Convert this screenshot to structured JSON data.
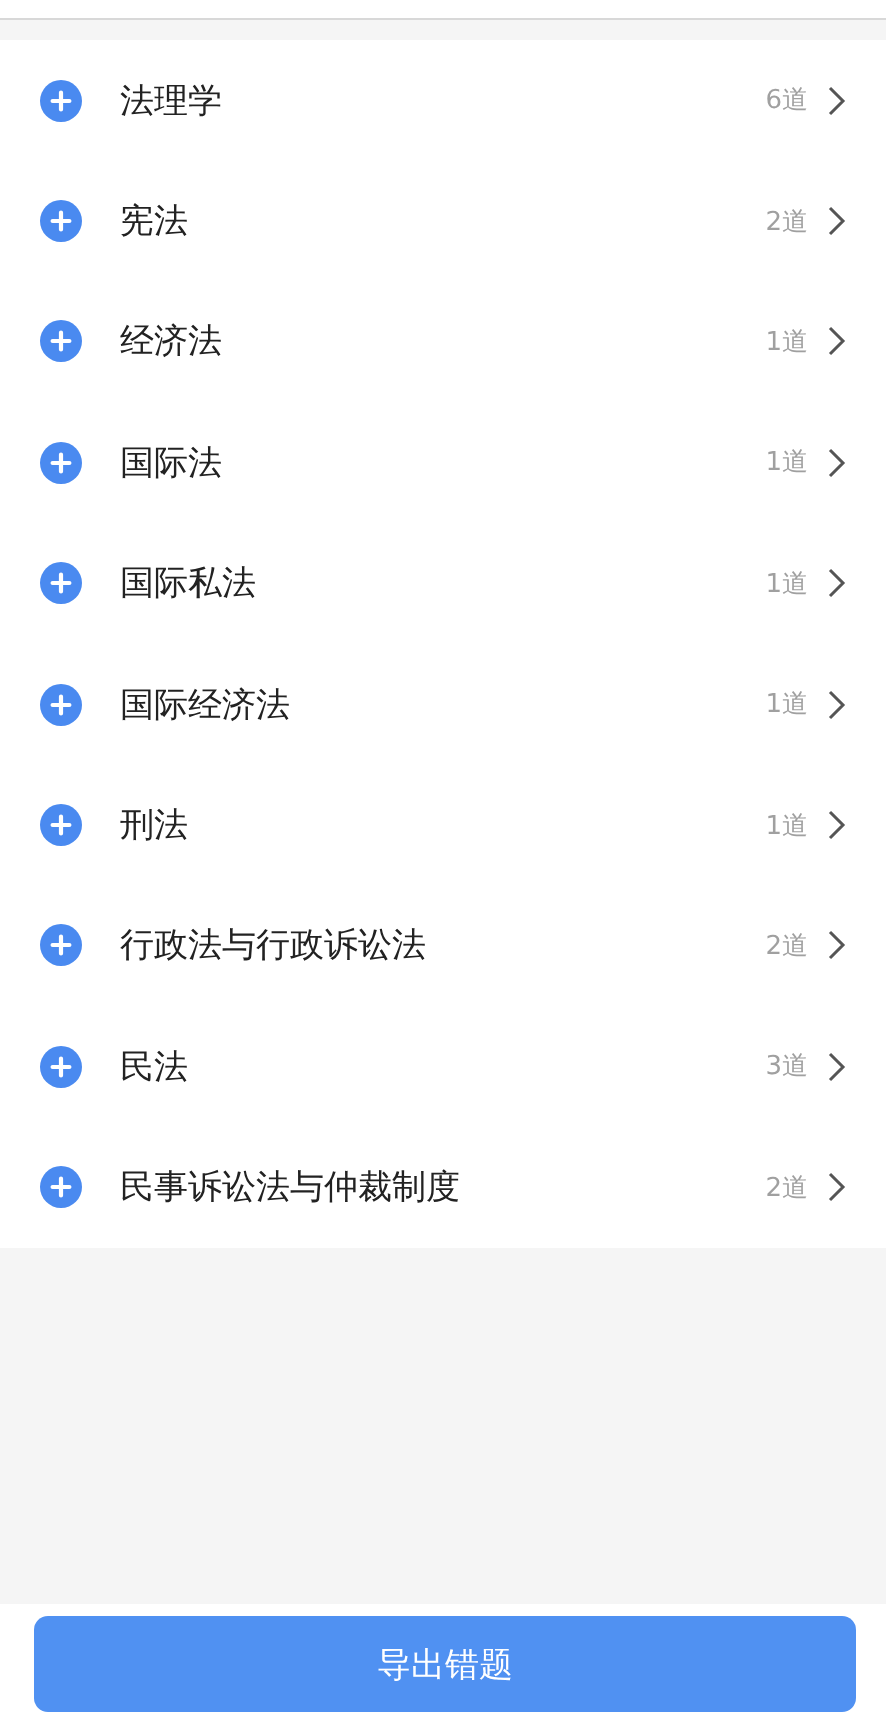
{
  "categories": [
    {
      "name": "法理学",
      "count": "6道"
    },
    {
      "name": "宪法",
      "count": "2道"
    },
    {
      "name": "经济法",
      "count": "1道"
    },
    {
      "name": "国际法",
      "count": "1道"
    },
    {
      "name": "国际私法",
      "count": "1道"
    },
    {
      "name": "国际经济法",
      "count": "1道"
    },
    {
      "name": "刑法",
      "count": "1道"
    },
    {
      "name": "行政法与行政诉讼法",
      "count": "2道"
    },
    {
      "name": "民法",
      "count": "3道"
    },
    {
      "name": "民事诉讼法与仲裁制度",
      "count": "2道"
    }
  ],
  "export_button": "导出错题"
}
